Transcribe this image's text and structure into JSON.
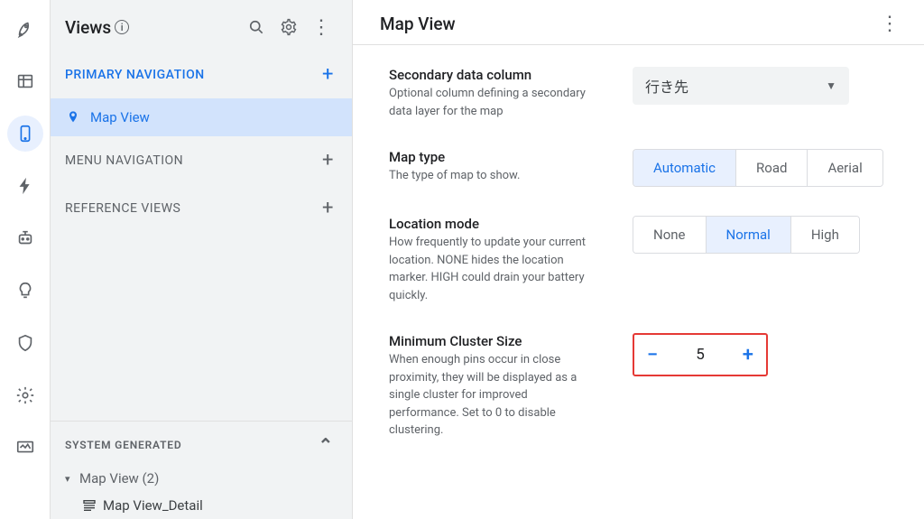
{
  "rail": {
    "icons": [
      "rocket",
      "data",
      "device",
      "bolt",
      "robot",
      "idea",
      "shield",
      "gear",
      "monitor"
    ]
  },
  "sidebar": {
    "title": "Views",
    "sections": {
      "primary": {
        "label": "PRIMARY NAVIGATION",
        "item": "Map View"
      },
      "menu": {
        "label": "MENU NAVIGATION"
      },
      "reference": {
        "label": "REFERENCE VIEWS"
      }
    },
    "systemGenerated": {
      "header": "SYSTEM GENERATED",
      "parent": "Map View (2)",
      "child": "Map View_Detail"
    }
  },
  "main": {
    "title": "Map View",
    "fields": {
      "secondaryData": {
        "title": "Secondary data column",
        "desc": "Optional column defining a secondary data layer for the map",
        "value": "行き先"
      },
      "mapType": {
        "title": "Map type",
        "desc": "The type of map to show.",
        "options": [
          "Automatic",
          "Road",
          "Aerial"
        ],
        "selected": "Automatic"
      },
      "locationMode": {
        "title": "Location mode",
        "desc": "How frequently to update your current location. NONE hides the location marker. HIGH could drain your battery quickly.",
        "options": [
          "None",
          "Normal",
          "High"
        ],
        "selected": "Normal"
      },
      "minCluster": {
        "title": "Minimum Cluster Size",
        "desc": "When enough pins occur in close proximity, they will be displayed as a single cluster for improved performance. Set to 0 to disable clustering.",
        "value": "5"
      }
    }
  }
}
